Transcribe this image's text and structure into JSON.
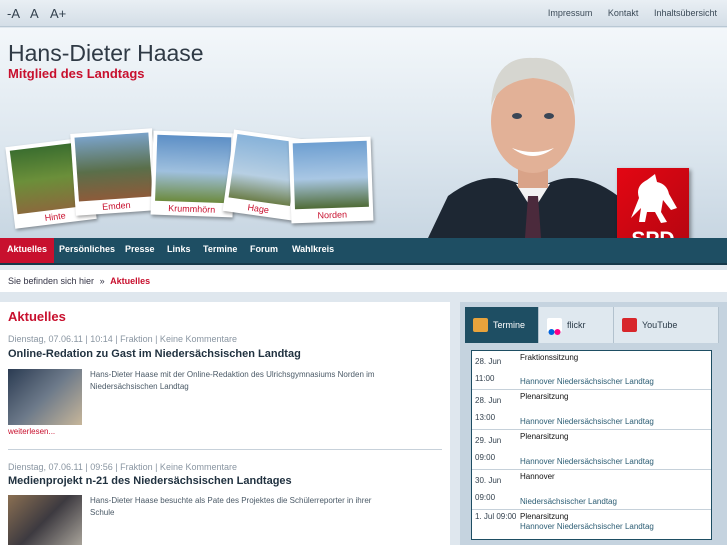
{
  "font_sizes": [
    "-A",
    "A",
    "A+"
  ],
  "top_links": [
    "Impressum",
    "Kontakt",
    "Inhaltsübersicht"
  ],
  "header": {
    "name": "Hans-Dieter Haase",
    "role": "Mitglied des Landtags",
    "polaroids": [
      "Hinte",
      "Emden",
      "Krummhörn",
      "Hage",
      "Norden"
    ],
    "logo_text": "SPD"
  },
  "nav": [
    "Aktuelles",
    "Persönliches",
    "Presse",
    "Links",
    "Termine",
    "Forum",
    "Wahlkreis"
  ],
  "breadcrumb": {
    "prefix": "Sie befinden sich hier",
    "sep": "»",
    "current": "Aktuelles"
  },
  "main": {
    "heading": "Aktuelles",
    "articles": [
      {
        "meta": "Dienstag, 07.06.11 | 10:14 | Fraktion | Keine Kommentare",
        "title": "Online-Redation zu Gast im Niedersächsischen Landtag",
        "text": "Hans-Dieter Haase mit der Online-Redaktion des Ulrichsgymnasiums Norden im Niedersächsischen Landtag",
        "more": "weiterlesen..."
      },
      {
        "meta": "Dienstag, 07.06.11 | 09:56 | Fraktion | Keine Kommentare",
        "title": "Medienprojekt n-21 des Niedersächsischen Landtages",
        "text": "Hans-Dieter Haase besuchte als Pate des Projektes die Schülerreporter in ihrer Schule"
      }
    ]
  },
  "sidebar": {
    "tabs": [
      "Termine",
      "flickr",
      "YouTube"
    ],
    "events": [
      {
        "date": "28. Jun",
        "time": "11:00",
        "title": "Fraktionssitzung",
        "location": "Hannover Niedersächsischer Landtag"
      },
      {
        "date": "28. Jun",
        "time": "13:00",
        "title": "Plenarsitzung",
        "location": "Hannover Niedersächsischer Landtag"
      },
      {
        "date": "29. Jun",
        "time": "09:00",
        "title": "Plenarsitzung",
        "location": "Hannover Niedersächsischer Landtag"
      },
      {
        "date": "30. Jun",
        "time": "09:00",
        "title": "Hannover",
        "location": "Niedersächsischer Landtag"
      },
      {
        "date": "1. Jul 09:00",
        "time": "",
        "title": "Plenarsitzung",
        "location": "Hannover Niedersächsischer Landtag"
      }
    ]
  },
  "colors": {
    "accent": "#c8102e",
    "nav_bg": "#1e4e63"
  }
}
